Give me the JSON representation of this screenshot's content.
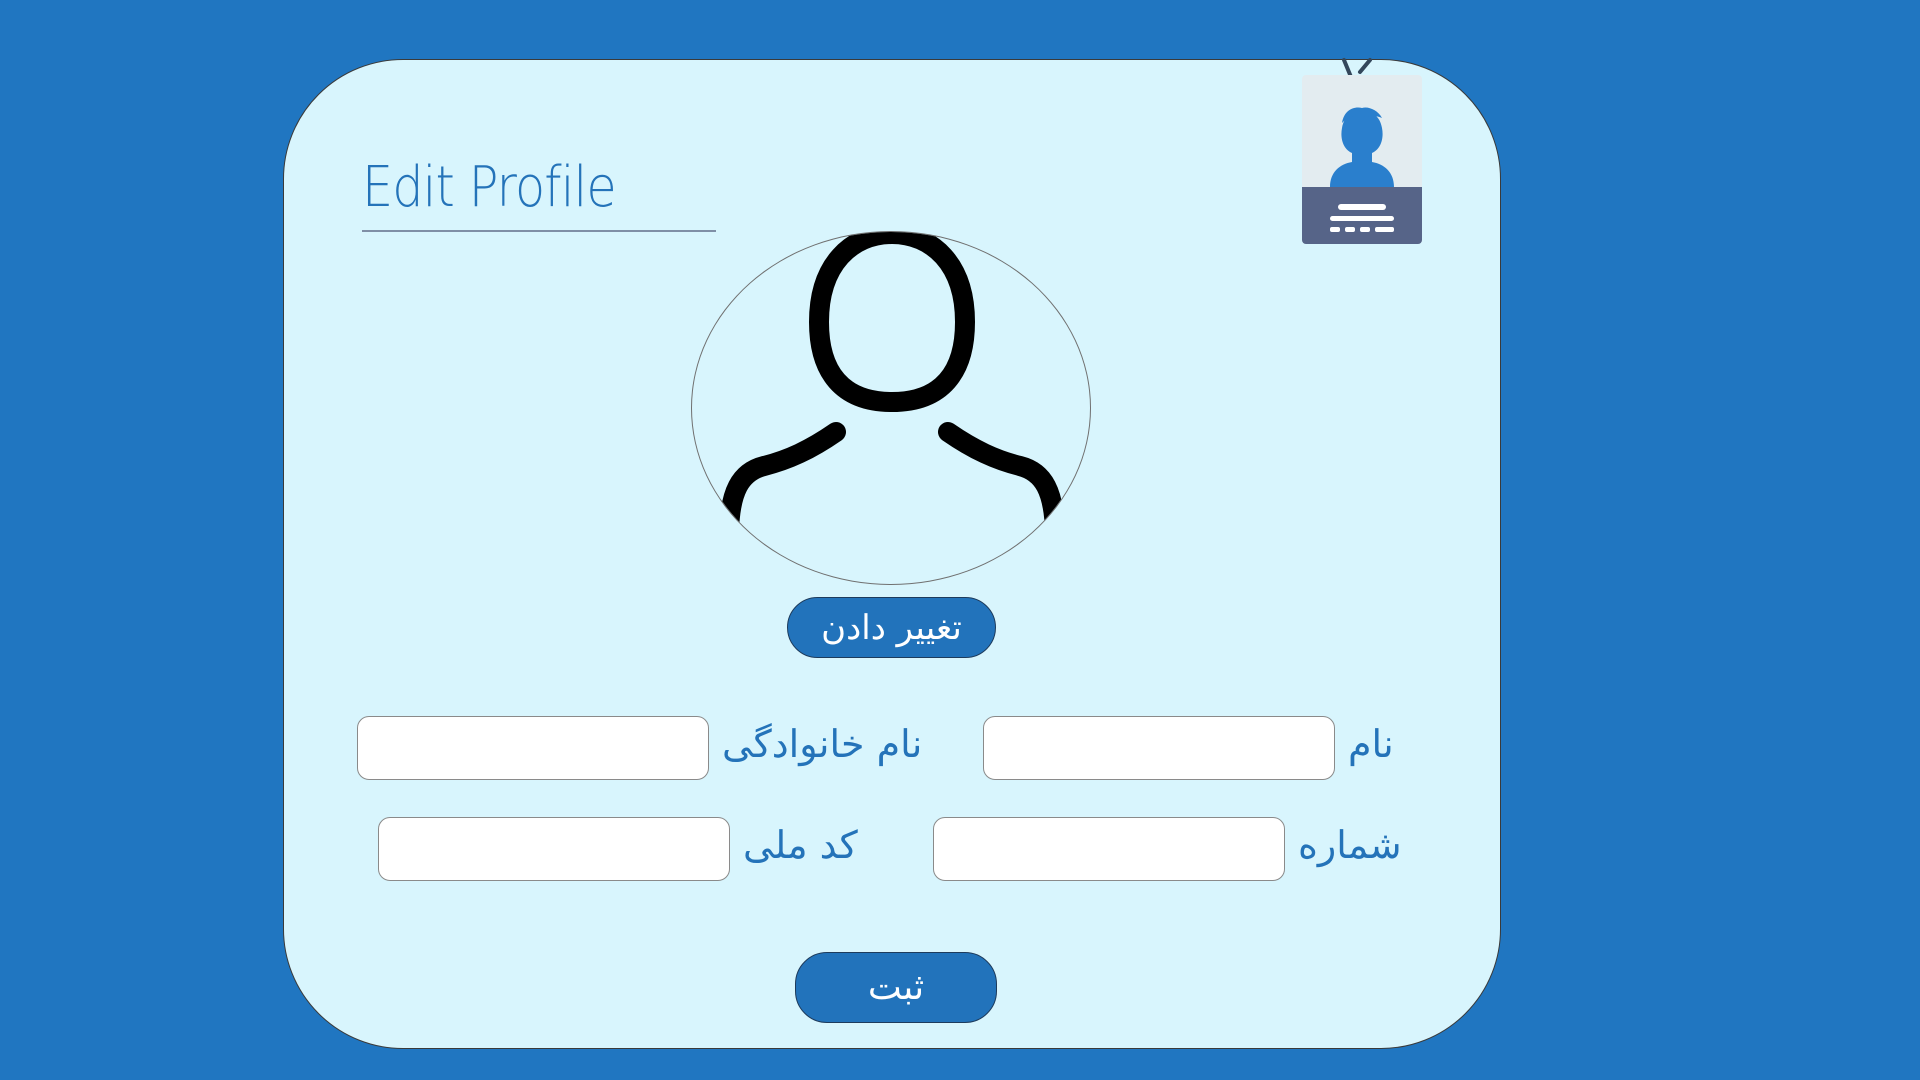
{
  "page": {
    "title": "Edit Profile"
  },
  "avatar": {
    "change_button": "تغییر دادن"
  },
  "form": {
    "first_name": {
      "label": "نام",
      "value": "",
      "placeholder": ""
    },
    "last_name": {
      "label": "نام خانوادگی",
      "value": "",
      "placeholder": ""
    },
    "phone": {
      "label": "شماره",
      "value": "",
      "placeholder": ""
    },
    "national_code": {
      "label": "کد ملی",
      "value": "",
      "placeholder": ""
    },
    "submit_button": "ثبت"
  },
  "colors": {
    "background": "#2076c1",
    "card": "#d8f5fd",
    "accent": "#2473b9",
    "badge_panel": "#566488"
  },
  "icons": {
    "avatar": "user-outline-icon",
    "badge": "id-badge-icon"
  }
}
